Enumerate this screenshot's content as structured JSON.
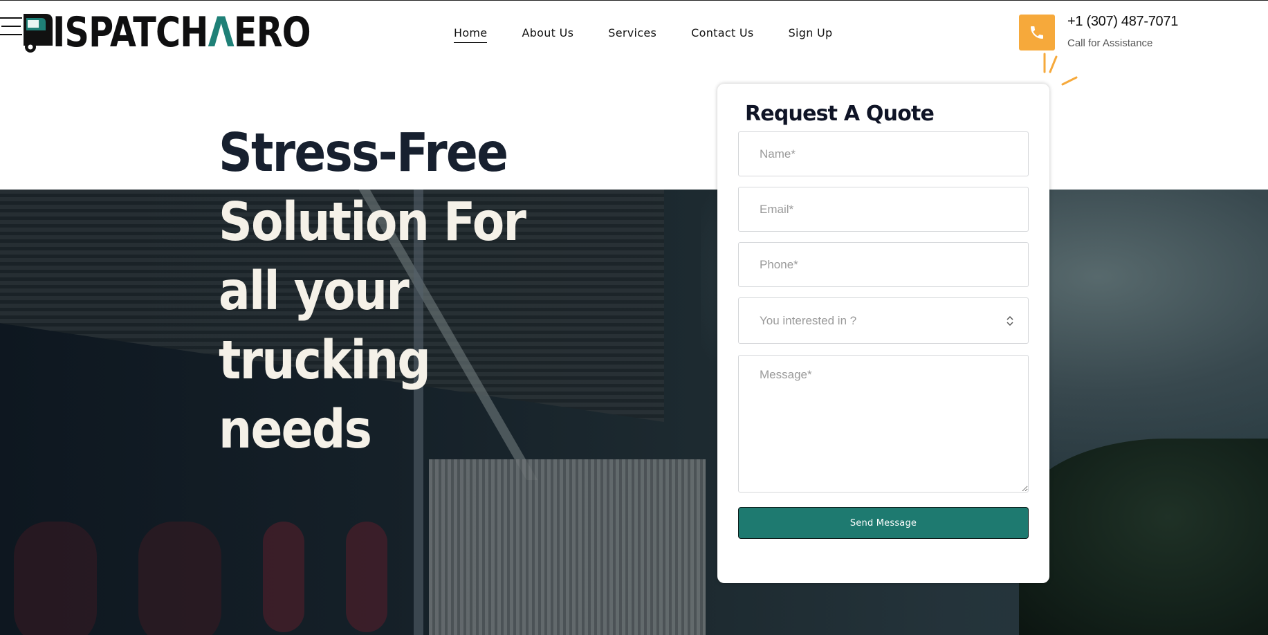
{
  "brand": {
    "logo_text_prefix": "ISPATCH",
    "logo_text_accent": "Λ",
    "logo_text_suffix": "ERO",
    "accent_color": "#1f8077"
  },
  "nav": {
    "items": [
      {
        "label": "Home",
        "active": true
      },
      {
        "label": "About Us",
        "active": false
      },
      {
        "label": "Services",
        "active": false
      },
      {
        "label": "Contact Us",
        "active": false
      },
      {
        "label": "Sign Up",
        "active": false
      }
    ]
  },
  "contact": {
    "phone": "+1 (307) 487-7071",
    "subtitle": "Call for Assistance",
    "icon": "phone-icon",
    "icon_bg_color": "#f6a93b"
  },
  "hero": {
    "headline_line1": "Stress-Free",
    "headline_rest": "Solution For all your trucking needs"
  },
  "form": {
    "title": "Request A Quote",
    "name_placeholder": "Name*",
    "email_placeholder": "Email*",
    "phone_placeholder": "Phone*",
    "interest_placeholder": "You interested in ?",
    "message_placeholder": "Message*",
    "submit_label": "Send Message",
    "submit_color": "#1e7a70"
  }
}
